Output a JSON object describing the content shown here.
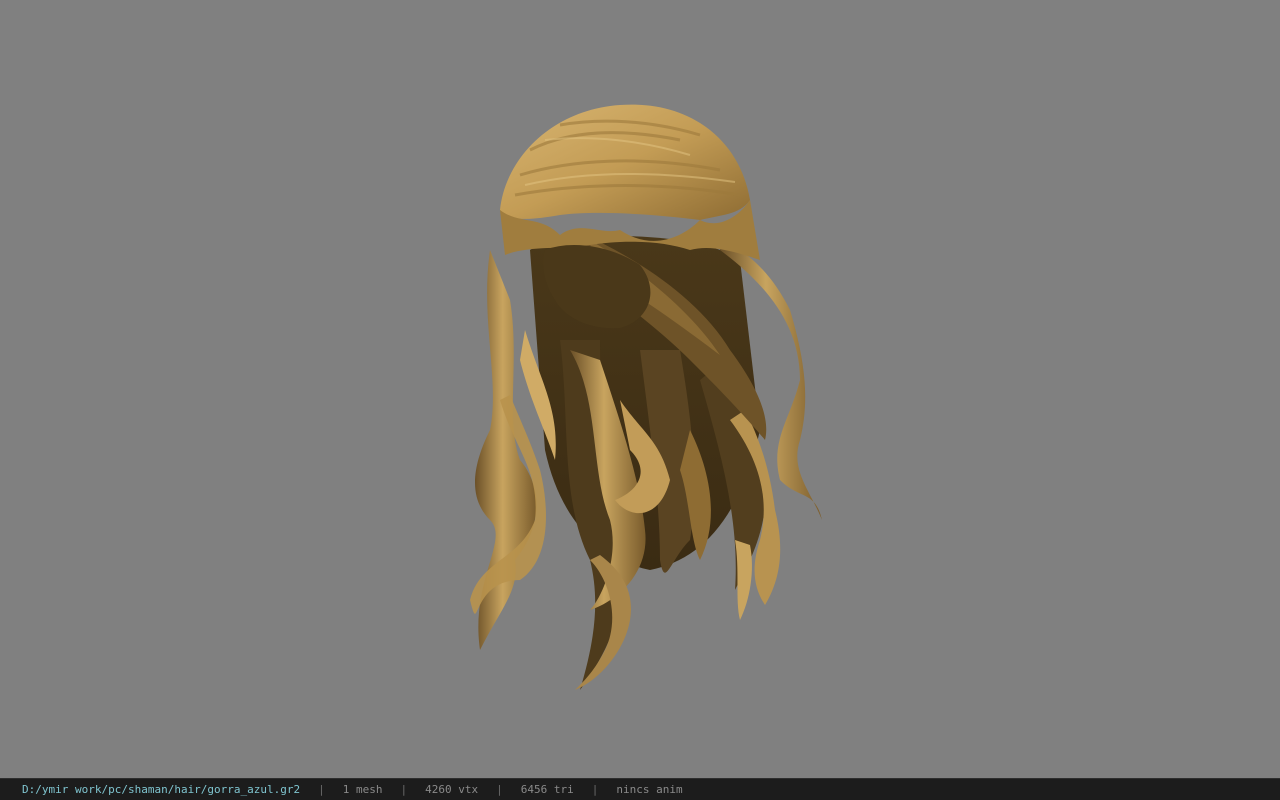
{
  "viewer": {
    "background_color": "#808080",
    "model_colors": {
      "light": "#c9a45e",
      "mid": "#a07d3e",
      "dark": "#5a4422",
      "shadow": "#3d2e17"
    }
  },
  "statusbar": {
    "file_path": "D:/ymir work/pc/shaman/hair/gorra_azul.gr2",
    "separator": "|",
    "mesh_count": "1 mesh",
    "vertex_count": "4260 vtx",
    "triangle_count": "6456 tri",
    "anim_status": "nincs anim"
  }
}
